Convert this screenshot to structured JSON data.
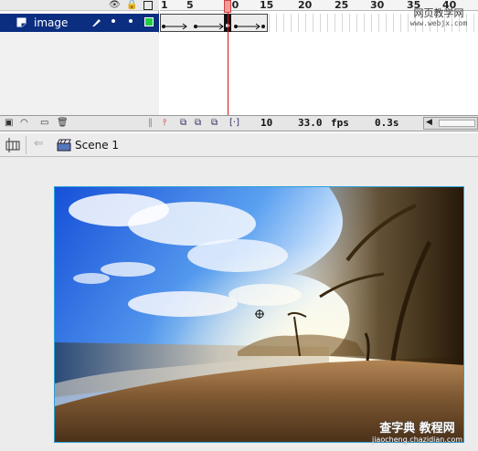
{
  "timeline": {
    "layer_name": "image",
    "ruler_numbers": [
      "1",
      "5",
      "10",
      "15",
      "20",
      "25",
      "30",
      "35",
      "40"
    ],
    "current_frame": "10",
    "frame_rate": "33.0",
    "fps_label": "fps",
    "elapsed_time": "0.3s"
  },
  "editbar": {
    "scene_label": "Scene 1"
  },
  "watermarks": {
    "top_line1": "网页教学网",
    "top_line2": "www.webjx.com",
    "bottom_line1": "查字典 教程网",
    "bottom_line2": "jiaocheng.chazidian.com"
  },
  "colors": {
    "layer_highlight": "#0c2e80",
    "playhead": "#dd1111",
    "stage_border": "#2aa0d8",
    "layer_color_swatch": "#22cc44"
  }
}
